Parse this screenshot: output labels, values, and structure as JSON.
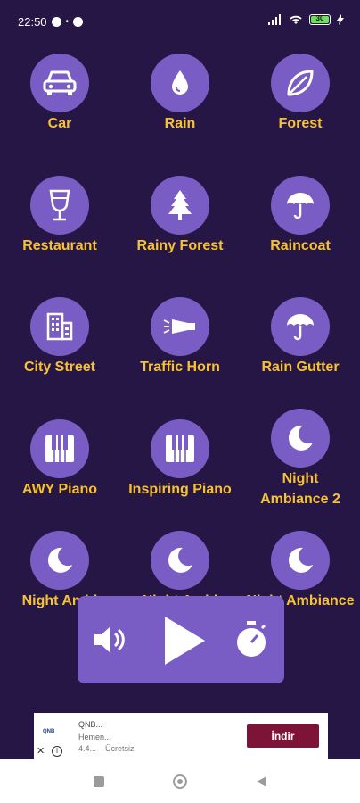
{
  "status_bar": {
    "time": "22:50",
    "battery_level": "30",
    "colors": {
      "battery": "#6ee05a"
    }
  },
  "sounds": [
    {
      "label": "Car",
      "icon": "car-icon"
    },
    {
      "label": "Rain",
      "icon": "raindrop-icon"
    },
    {
      "label": "Forest",
      "icon": "leaf-icon"
    },
    {
      "label": "Restaurant",
      "icon": "wine-glass-icon"
    },
    {
      "label": "Rainy Forest",
      "icon": "pine-tree-icon"
    },
    {
      "label": "Raincoat",
      "icon": "umbrella-icon"
    },
    {
      "label": "City Street",
      "icon": "building-icon"
    },
    {
      "label": "Traffic Horn",
      "icon": "horn-icon"
    },
    {
      "label": "Rain Gutter",
      "icon": "umbrella-icon"
    },
    {
      "label": "AWY Piano",
      "icon": "piano-icon"
    },
    {
      "label": "Inspiring Piano",
      "icon": "piano-icon"
    },
    {
      "label": "Night Ambiance 2",
      "icon": "moon-icon"
    },
    {
      "label": "Night Ambi",
      "icon": "moon-icon"
    },
    {
      "label": "Night Ambi",
      "icon": "moon-icon"
    },
    {
      "label": "Night Ambiance",
      "icon": "moon-icon"
    }
  ],
  "player": {
    "volume_icon": "volume-icon",
    "play_icon": "play-icon",
    "timer_icon": "stopwatch-icon"
  },
  "ad": {
    "brand": "QNB",
    "title": "QNB...",
    "subtitle": "Hemen...",
    "rating": "4.4...",
    "price": "Ücretsiz",
    "cta": "İndir",
    "close": "✕",
    "info": "i"
  },
  "colors": {
    "background": "#261645",
    "accent": "#7a5dc4",
    "label": "#f7c230",
    "ad_button": "#7d1438"
  }
}
